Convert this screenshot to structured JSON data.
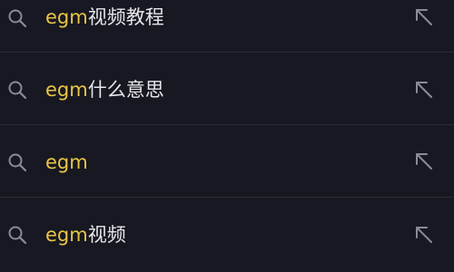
{
  "suggestions": [
    {
      "keyword": "egm",
      "rest": "视频教程"
    },
    {
      "keyword": "egm",
      "rest": "什么意思"
    },
    {
      "keyword": "egm",
      "rest": ""
    },
    {
      "keyword": "egm",
      "rest": "视频"
    }
  ],
  "colors": {
    "background": "#171821",
    "keyword": "#e8c547",
    "text": "#e6e6ea",
    "icon": "#8a8b94",
    "divider": "#2a2b35"
  },
  "icons": {
    "search": "search-icon",
    "fill": "arrow-up-left-icon"
  }
}
